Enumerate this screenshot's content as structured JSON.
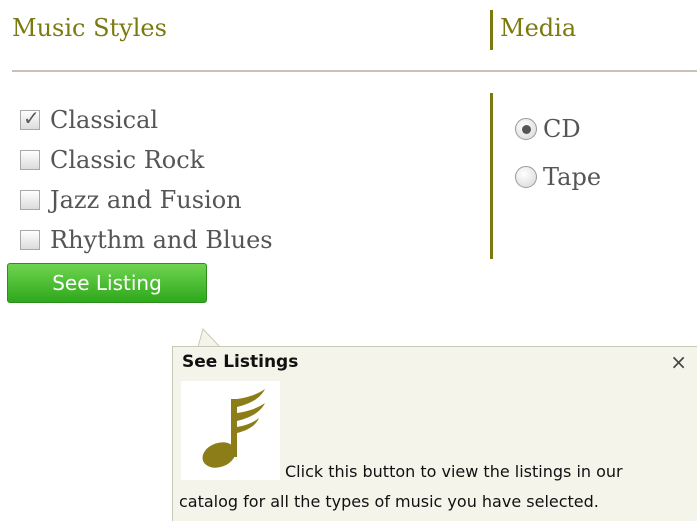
{
  "headers": {
    "music_styles": "Music Styles",
    "media": "Media"
  },
  "music_styles": [
    {
      "label": "Classical",
      "checked": true
    },
    {
      "label": "Classic Rock",
      "checked": false
    },
    {
      "label": "Jazz and Fusion",
      "checked": false
    },
    {
      "label": "Rhythm and Blues",
      "checked": false
    }
  ],
  "media": [
    {
      "label": "CD",
      "selected": true
    },
    {
      "label": "Tape",
      "selected": false
    }
  ],
  "button": {
    "label": "See Listing"
  },
  "tooltip": {
    "title": "See Listings",
    "close": "×",
    "image_icon": "music-note-icon",
    "line1": "Click this button to view the listings in our",
    "line2": "catalog for all the types of music you have selected."
  },
  "colors": {
    "accent": "#7a7a10",
    "button_green": "#3db526",
    "tooltip_bg": "#f4f4ea",
    "note_olive": "#8c7d18"
  }
}
